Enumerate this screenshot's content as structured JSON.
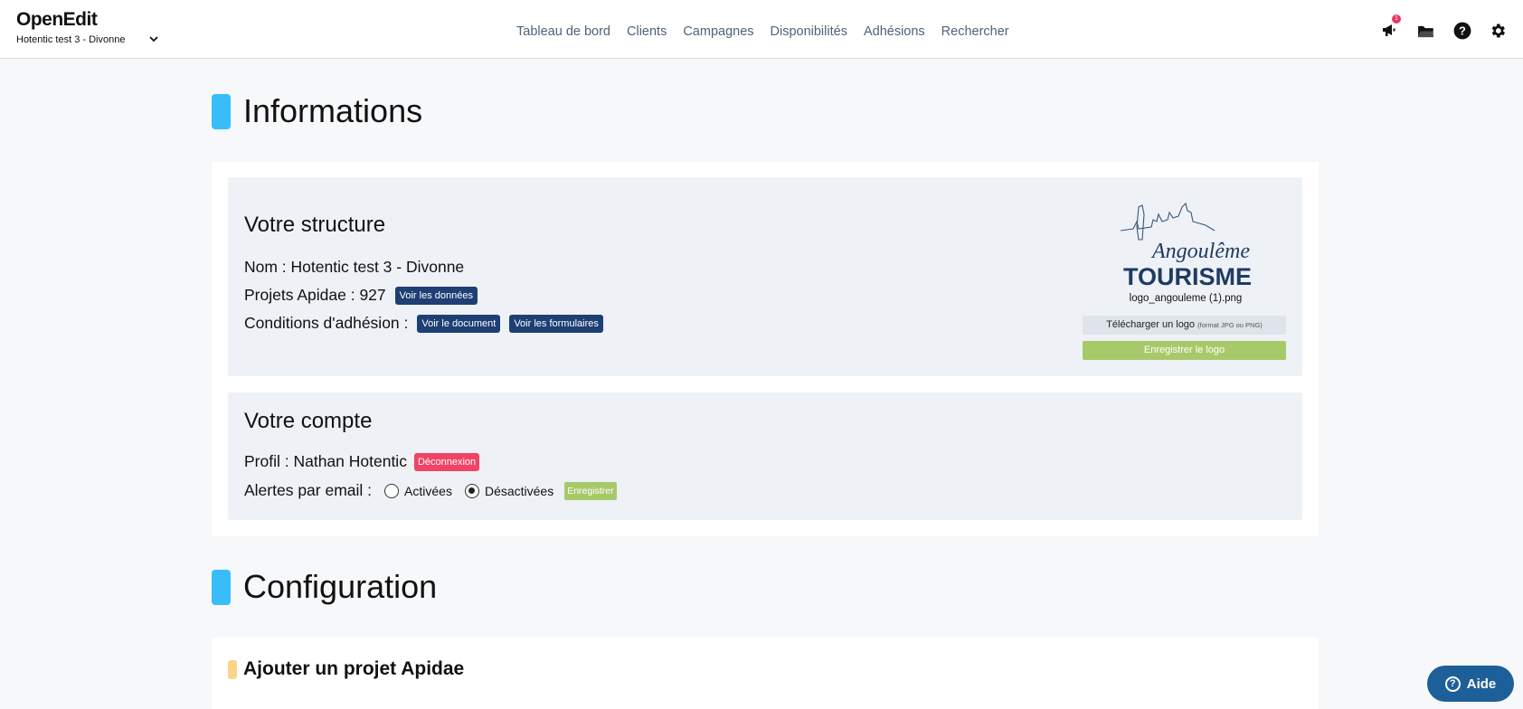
{
  "header": {
    "brand": "OpenEdit",
    "site_selector": "Hotentic test 3 - Divonne",
    "notification_count": "1",
    "nav": [
      "Tableau de bord",
      "Clients",
      "Campagnes",
      "Disponibilités",
      "Adhésions",
      "Rechercher"
    ],
    "icons": [
      "megaphone-icon",
      "folder-icon",
      "question-circle-icon",
      "gear-icon"
    ]
  },
  "informations": {
    "title": "Informations",
    "structure": {
      "title": "Votre structure",
      "nom": "Nom : Hotentic test 3 - Divonne",
      "projets": "Projets Apidae : 927",
      "voir_donnees": "Voir les données",
      "conditions": "Conditions d'adhésion :",
      "voir_document": "Voir le document",
      "voir_formulaires": "Voir les formulaires",
      "logo_script": "Angoulême",
      "logo_word": "TOURISME",
      "logo_filename": "logo_angouleme (1).png",
      "upload_label": "Télécharger un logo",
      "upload_hint": "(format JPG ou PNG)",
      "save_logo": "Enregistrer le logo"
    },
    "compte": {
      "title": "Votre compte",
      "profil": "Profil : Nathan Hotentic",
      "deconnexion": "Déconnexion",
      "alertes": "Alertes par email :",
      "option_on": "Activées",
      "option_off": "Désactivées",
      "selected": "Désactivées",
      "save": "Enregistrer"
    }
  },
  "configuration": {
    "title": "Configuration",
    "sub_title": "Ajouter un projet Apidae"
  },
  "help": {
    "label": "Aide"
  },
  "colors": {
    "accent_blue": "#38bdf8",
    "dark_button": "#1e3f74",
    "danger": "#ef4466",
    "success": "#a8c96a",
    "help": "#1d5f99"
  }
}
